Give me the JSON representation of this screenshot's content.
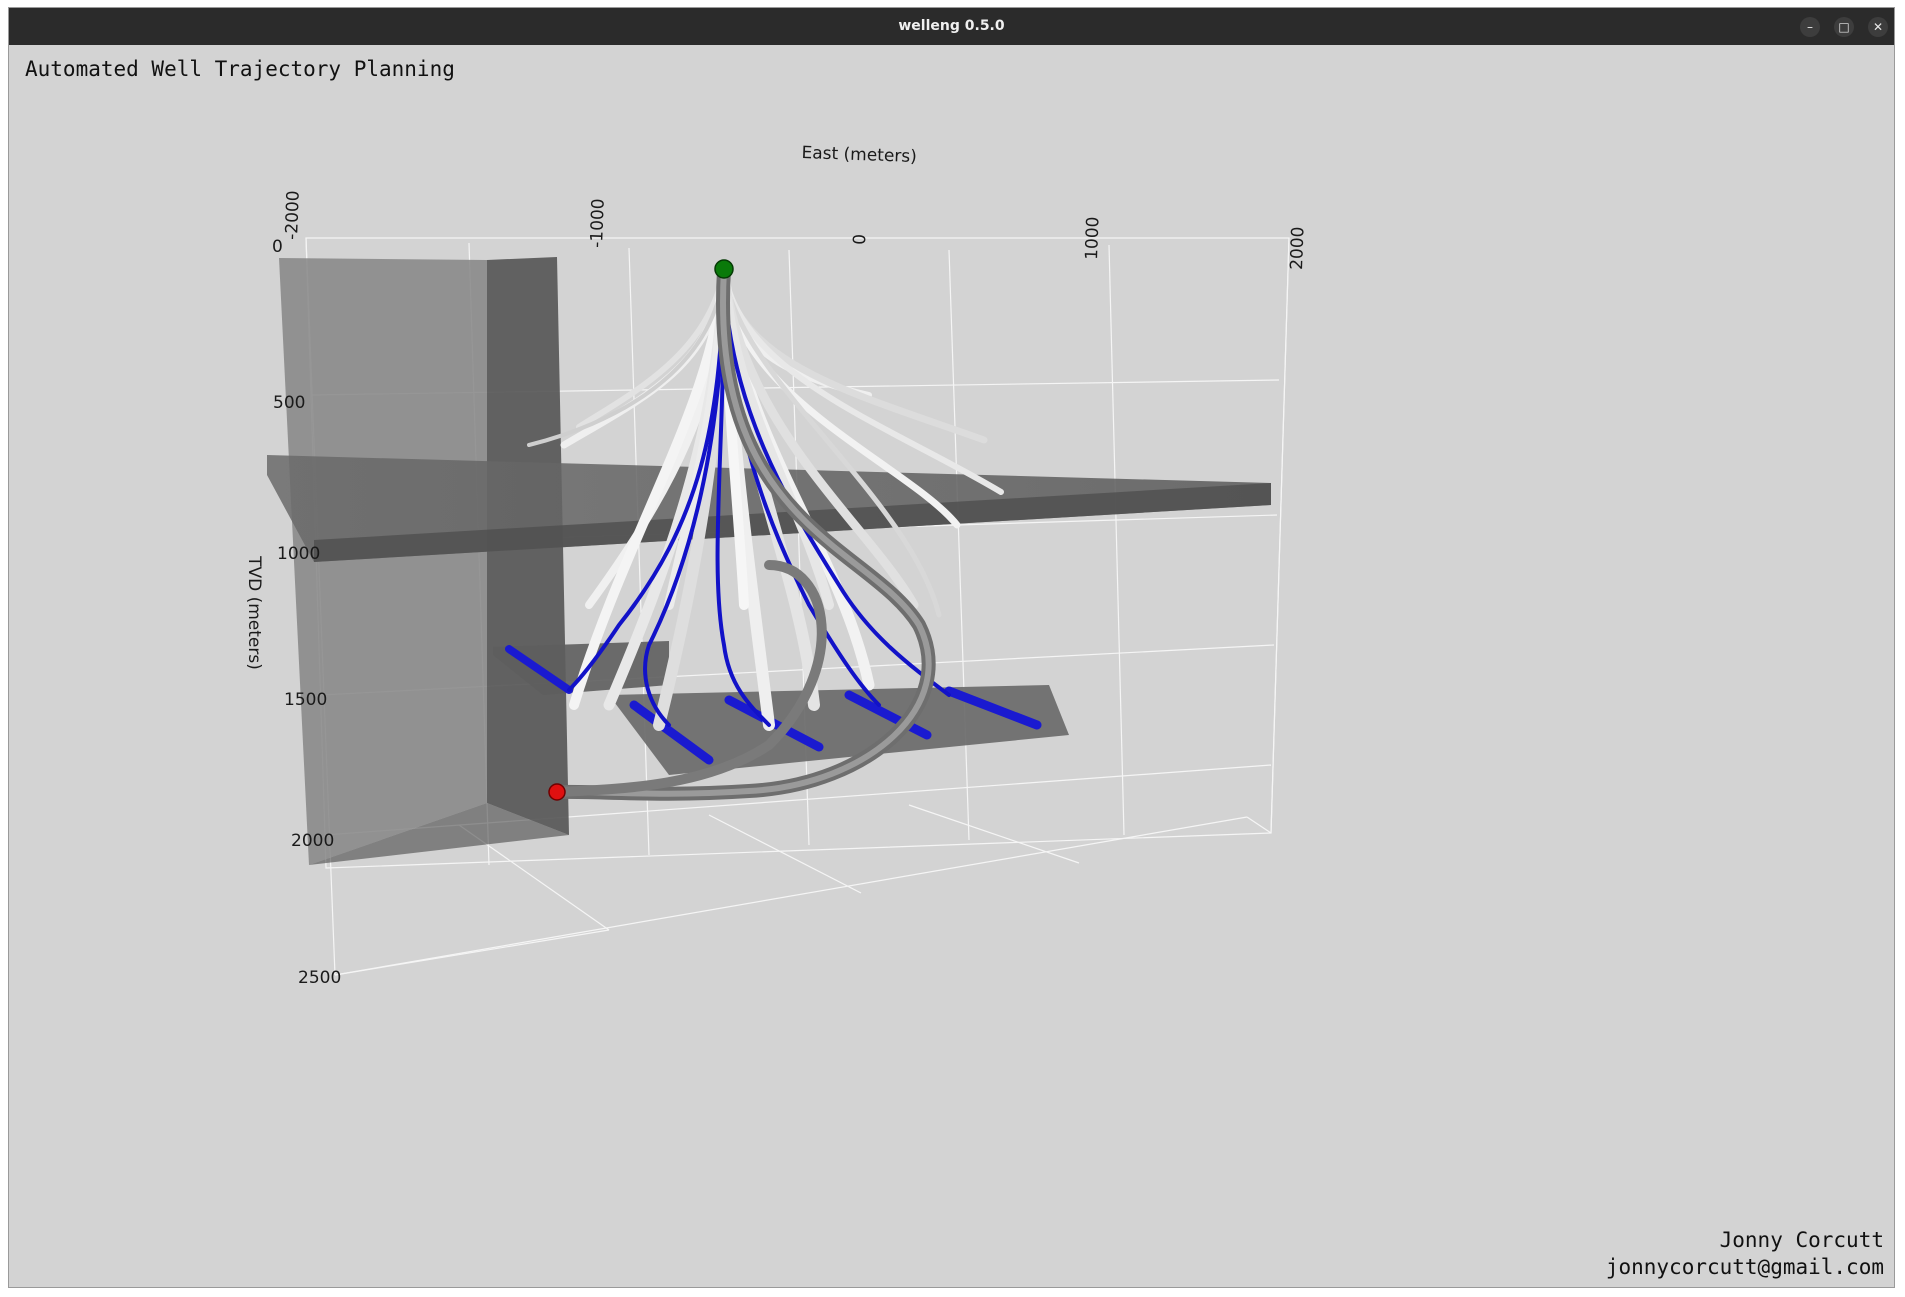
{
  "window": {
    "title": "welleng 0.5.0",
    "controls": {
      "minimize": "–",
      "maximize": "□",
      "close": "✕"
    }
  },
  "scene": {
    "heading": "Automated Well Trajectory Planning",
    "author_name": "Jonny Corcutt",
    "author_email": "jonnycorcutt@gmail.com",
    "background_color": "#d3d3d3",
    "surface_location_color": "#0a7a0a",
    "target_marker_color": "#e01010",
    "selected_wells_color": "#1010c8",
    "candidate_wells_color": "#e6e6e6"
  },
  "axes": {
    "east_label": "East (meters)",
    "east_ticks": [
      "-2000",
      "-1000",
      "0",
      "1000",
      "2000"
    ],
    "tvd_label": "TVD (meters)",
    "tvd_ticks": [
      "0",
      "500",
      "1000",
      "1500",
      "2000",
      "2500"
    ]
  }
}
